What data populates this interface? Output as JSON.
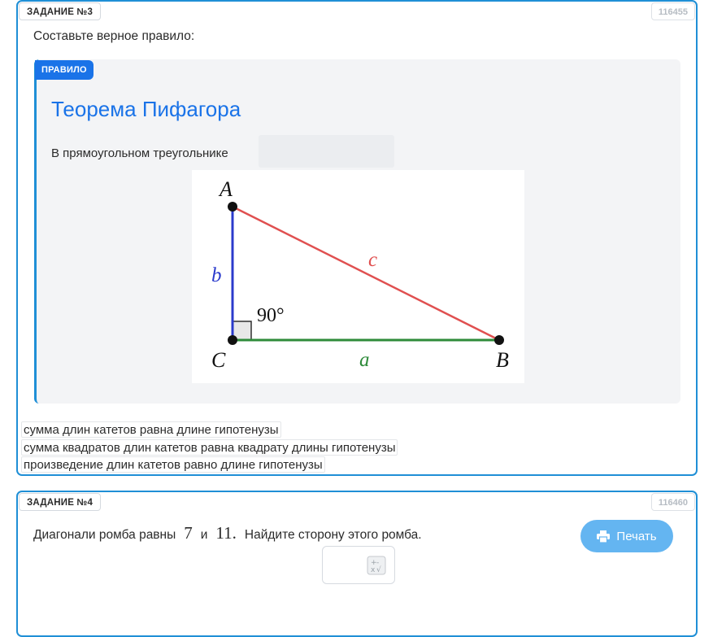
{
  "task3": {
    "label": "ЗАДАНИЕ №3",
    "id": "116455",
    "prompt": "Составьте верное правило:",
    "rule": {
      "badge": "ПРАВИЛО",
      "title": "Теорема Пифагора",
      "text": "В прямоугольном треугольнике"
    },
    "figure": {
      "vertex_a": "A",
      "vertex_b": "B",
      "vertex_c": "C",
      "side_a": "a",
      "side_b": "b",
      "side_c": "c",
      "angle": "90°",
      "colors": {
        "side_a": "#2e8b3a",
        "side_b": "#2b3bcc",
        "side_c": "#e05050"
      }
    },
    "options": [
      "сумма длин катетов равна длине гипотенузы",
      "сумма квадратов длин катетов равна квадрату длины гипотенузы",
      "произведение длин катетов равно длине гипотенузы"
    ]
  },
  "task4": {
    "label": "ЗАДАНИЕ №4",
    "id": "116460",
    "prompt_part1": "Диагонали ромба равны",
    "value1": "7",
    "prompt_and": "и",
    "value2": "11.",
    "prompt_part2": "Найдите сторону этого ромба.",
    "print_label": "Печать",
    "answer_value": ""
  },
  "colors": {
    "accent": "#1f8fd6",
    "title_blue": "#1a73e8",
    "print_button": "#64b5f1"
  }
}
